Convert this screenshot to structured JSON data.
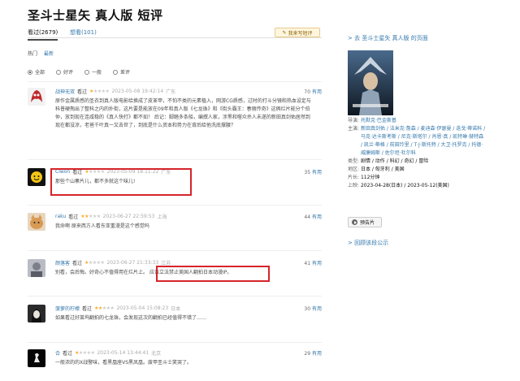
{
  "page": {
    "title": "圣斗士星矢 真人版 短评"
  },
  "tabs": {
    "seen": "看过(2679)",
    "want": "想看(101)"
  },
  "write_button": "我来写短评",
  "sort": {
    "hot": "热门",
    "latest": "最新"
  },
  "filter": {
    "all": "全部",
    "good": "好评",
    "mid": "一般",
    "bad": "差评"
  },
  "comments": [
    {
      "user": "战神无双",
      "status": "看过",
      "stars": 1,
      "time": "2023-05-08 19:42:14",
      "location": "广东",
      "votes": "70",
      "vote_label": "有用",
      "text": "原作金属质感的圣衣到真人版电影给换成了皮革甲，不怕不类的元素植入，网游CG质感，过时的打斗分镜和热血设定与科普硬掏出了整科之内的扑街，这片要是能放在09年和真人版《七龙珠》和《街头霸王：春丽传奇》这俩烂片能分个伯仲，放到现在连咸稳的《真人快打》都不如！ 后记：脚踏多条船，编撰人家，涉黑和噬众杀人未遂的新田真剑佑居然到现在都没凉，老爸千叶真一又去世了，到底是什么资本和势力在背后给他洗底撑腰？"
    },
    {
      "user": "Clwon",
      "status": "看过",
      "stars": 1,
      "time": "2023-05-09 18:11:22",
      "location": "广东",
      "votes": "35",
      "vote_label": "有用",
      "text": "那些个山寨片儿，都不多就这个味儿!"
    },
    {
      "user": "raku",
      "status": "看过",
      "stars": 2,
      "time": "2023-06-27 22:59:53",
      "location": "上海",
      "votes": "44",
      "vote_label": "有用",
      "text": "我命啊 原来西方人看东亚重漫是这个感觉吗"
    },
    {
      "user": "颜落客",
      "status": "看过",
      "stars": 1,
      "time": "2023-06-27 21:33:33",
      "location": "江苏",
      "votes": "41",
      "vote_label": "有用",
      "text": "别看，会后悔。好奇心不值得用在烂片上。",
      "text_highlight": "应该立法禁止美国人翻拍日本动漫IP。"
    },
    {
      "user": "菠萝的柠檬",
      "status": "看过",
      "stars": 2,
      "time": "2023-05-04 15:08:23",
      "location": "日本",
      "votes": "30",
      "vote_label": "有用",
      "text": "如果看过好莱坞翻拍的七龙珠，会发现这次的翻拍已经值得不错了……"
    },
    {
      "user": "合",
      "status": "看过",
      "stars": 1,
      "time": "2023-05-14 13:44:41",
      "location": "北京",
      "votes": "29",
      "vote_label": "有用",
      "text": "一般浓的的X战警味，看黑凰座VS黑凤凰。废甲圣斗士笑哭了。"
    }
  ],
  "sidebar": {
    "back_link": "> 去 圣斗士星矢 真人版 的页面",
    "director_label": "导演:",
    "director": "托默克·巴金斯基",
    "cast_label": "主演:",
    "cast": "新田真剑佑 / 法米克·詹森 / 麦迪森·伊瑟曼 / 迭戈·蒂诺科 / 马克·达卡斯考斯 / 尼克·斯塔尔 / 肖恩·真 / 凯特琳·赫特森 / 凯兰·蒂格 / 前田玲里 / T·J·斯托特 / 大卫·托罗克 / 托德·威廉姆斯 / 佐尔坦·杜尔科",
    "genre_label": "类型:",
    "genre": "剧情 / 动作 / 科幻 / 奇幻 / 冒险",
    "region_label": "地区:",
    "region": "日本 / 匈牙利 / 美国",
    "length_label": "片长:",
    "length": "112分钟",
    "release_label": "上映:",
    "release": "2023-04-28(日本) / 2023-05-12(美国)",
    "trailer": "预告片",
    "all_link": "> 回顾该段公示"
  },
  "colors": {
    "link": "#3377aa",
    "star": "#ffac2d",
    "highlight": "#d6252a"
  }
}
